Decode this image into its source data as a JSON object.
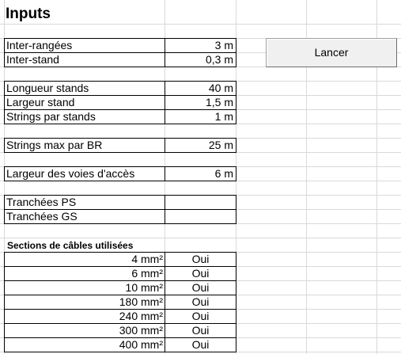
{
  "sheet": {
    "title": "Inputs",
    "inputs": [
      {
        "label": "Inter-rangées",
        "value": "3 m"
      },
      {
        "label": "Inter-stand",
        "value": "0,3 m"
      },
      {
        "label": "Longueur stands",
        "value": "40 m"
      },
      {
        "label": "Largeur stand",
        "value": "1,5 m"
      },
      {
        "label": "Strings par stands",
        "value": "1 m"
      },
      {
        "label": "Strings max par BR",
        "value": "25 m"
      },
      {
        "label": "Largeur des voies d'accès",
        "value": "6 m"
      },
      {
        "label": "Tranchées PS",
        "value": ""
      },
      {
        "label": "Tranchées GS",
        "value": ""
      }
    ],
    "cables": {
      "title": "Sections de câbles utilisées",
      "rows": [
        {
          "section": "4 mm²",
          "used": "Oui"
        },
        {
          "section": "6 mm²",
          "used": "Oui"
        },
        {
          "section": "10 mm²",
          "used": "Oui"
        },
        {
          "section": "180 mm²",
          "used": "Oui"
        },
        {
          "section": "240 mm²",
          "used": "Oui"
        },
        {
          "section": "300 mm²",
          "used": "Oui"
        },
        {
          "section": "400 mm²",
          "used": "Oui"
        }
      ]
    }
  },
  "button": {
    "label": "Lancer"
  }
}
